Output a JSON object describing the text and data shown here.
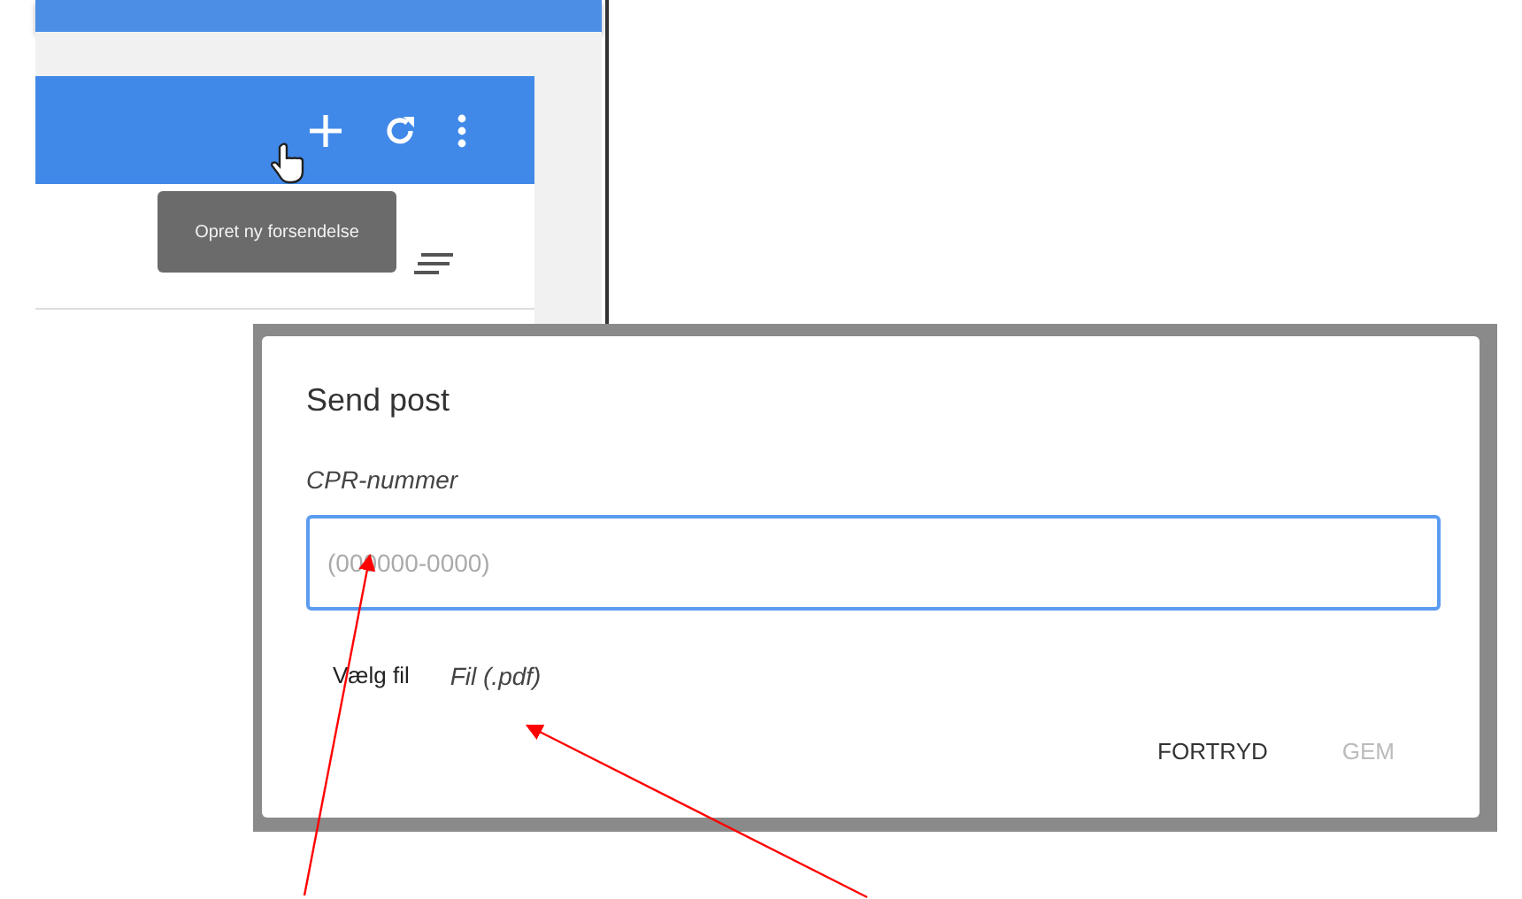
{
  "app_window": {
    "tooltip": "Opret ny forsendelse"
  },
  "dialog": {
    "title": "Send post",
    "field": {
      "label": "CPR-nummer",
      "placeholder": "(000000-0000)",
      "focused": true
    },
    "file_button": "Vælg fil",
    "file_label": "Fil (.pdf)",
    "buttons": [
      {
        "label": "FORTRYD",
        "disabled": false
      },
      {
        "label": "GEM",
        "disabled": true
      }
    ]
  }
}
